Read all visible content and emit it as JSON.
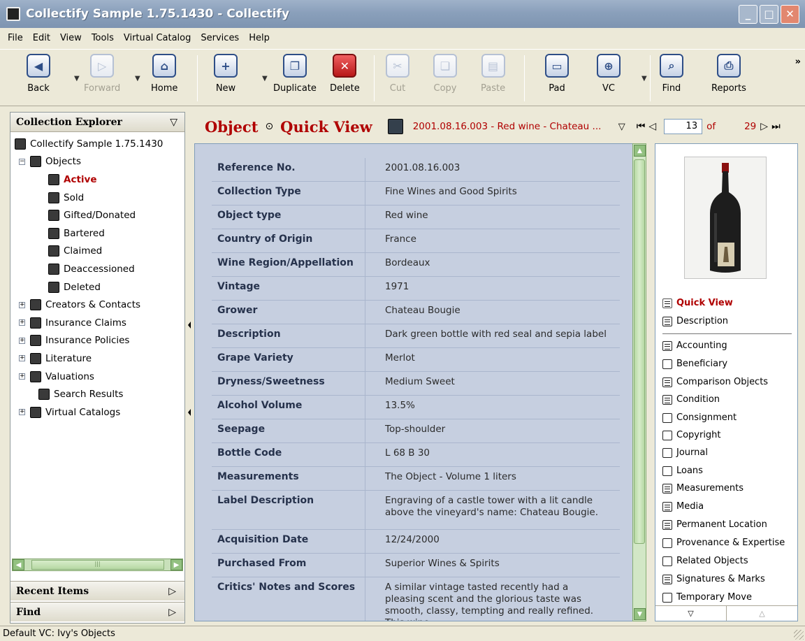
{
  "window": {
    "title": "Collectify Sample 1.75.1430 - Collectify"
  },
  "menu": [
    "File",
    "Edit",
    "View",
    "Tools",
    "Virtual Catalog",
    "Services",
    "Help"
  ],
  "toolbar": {
    "back": "Back",
    "forward": "Forward",
    "home": "Home",
    "new": "New",
    "duplicate": "Duplicate",
    "delete": "Delete",
    "cut": "Cut",
    "copy": "Copy",
    "paste": "Paste",
    "pad": "Pad",
    "vc": "VC",
    "find": "Find",
    "reports": "Reports",
    "more": "»"
  },
  "explorer": {
    "title": "Collection Explorer",
    "root": "Collectify Sample 1.75.1430",
    "objects": "Objects",
    "active": "Active",
    "sold": "Sold",
    "gifted": "Gifted/Donated",
    "bartered": "Bartered",
    "claimed": "Claimed",
    "deaccessioned": "Deaccessioned",
    "deleted": "Deleted",
    "creators": "Creators & Contacts",
    "claims": "Insurance Claims",
    "policies": "Insurance Policies",
    "literature": "Literature",
    "valuations": "Valuations",
    "search": "Search Results",
    "catalogs": "Virtual Catalogs",
    "recent": "Recent Items",
    "find": "Find"
  },
  "header": {
    "object": "Object",
    "quickview": "Quick View",
    "reference": "2001.08.16.003 - Red wine - Chateau ...",
    "page": "13",
    "of": "of",
    "total": "29"
  },
  "fields": [
    {
      "label": "Reference No.",
      "value": "2001.08.16.003"
    },
    {
      "label": "Collection Type",
      "value": "Fine Wines and Good Spirits"
    },
    {
      "label": "Object type",
      "value": "Red wine"
    },
    {
      "label": "Country of Origin",
      "value": "France"
    },
    {
      "label": "Wine Region/Appellation",
      "value": "Bordeaux"
    },
    {
      "label": "Vintage",
      "value": "1971"
    },
    {
      "label": "Grower",
      "value": "Chateau Bougie"
    },
    {
      "label": "Description",
      "value": "Dark green bottle with red seal and sepia label"
    },
    {
      "label": "Grape Variety",
      "value": "Merlot"
    },
    {
      "label": "Dryness/Sweetness",
      "value": "Medium Sweet"
    },
    {
      "label": "Alcohol Volume",
      "value": "13.5%"
    },
    {
      "label": "Seepage",
      "value": "Top-shoulder"
    },
    {
      "label": "Bottle Code",
      "value": "L 68 B 30"
    },
    {
      "label": "Measurements",
      "value": "The Object - Volume 1 liters"
    },
    {
      "label": "Label Description",
      "value": "Engraving of a castle tower with a lit candle above the vineyard's name: Chateau Bougie."
    },
    {
      "label": "Acquisition Date",
      "value": "12/24/2000"
    },
    {
      "label": "Purchased From",
      "value": "Superior Wines & Spirits"
    },
    {
      "label": "Critics' Notes and Scores",
      "value": "A similar vintage tasted recently had a pleasing scent and the glorious taste was smooth, classy, tempting and really refined. This wine"
    }
  ],
  "sections": [
    {
      "label": "Quick View",
      "filled": true
    },
    {
      "label": "Description",
      "filled": true
    },
    {
      "label": "Accounting",
      "filled": true
    },
    {
      "label": "Beneficiary",
      "filled": false
    },
    {
      "label": "Comparison Objects",
      "filled": true
    },
    {
      "label": "Condition",
      "filled": true
    },
    {
      "label": "Consignment",
      "filled": false
    },
    {
      "label": "Copyright",
      "filled": false
    },
    {
      "label": "Journal",
      "filled": false
    },
    {
      "label": "Loans",
      "filled": false
    },
    {
      "label": "Measurements",
      "filled": true
    },
    {
      "label": "Media",
      "filled": true
    },
    {
      "label": "Permanent Location",
      "filled": true
    },
    {
      "label": "Provenance & Expertise",
      "filled": false
    },
    {
      "label": "Related Objects",
      "filled": false
    },
    {
      "label": "Signatures & Marks",
      "filled": true
    },
    {
      "label": "Temporary Move",
      "filled": false
    }
  ],
  "status": "Default VC: Ivy's Objects",
  "colors": {
    "accent": "#b00000",
    "form_bg": "#c6cfe0",
    "scroll_green": "#93c181"
  }
}
